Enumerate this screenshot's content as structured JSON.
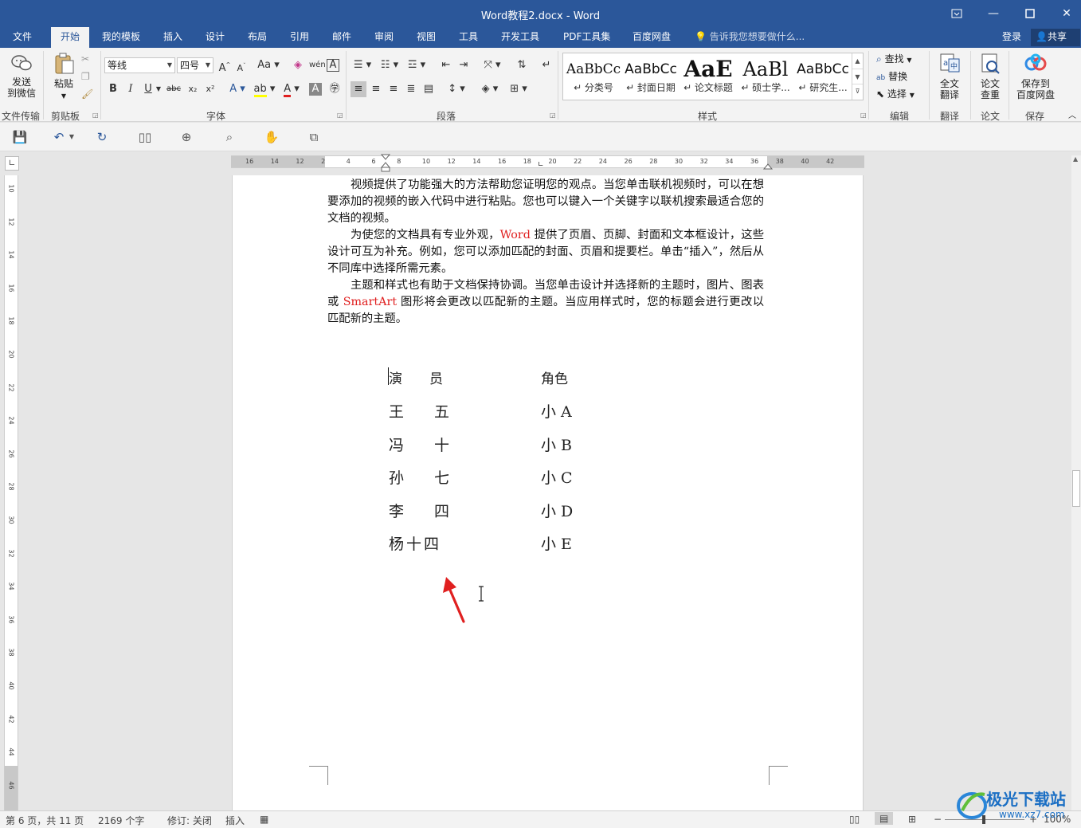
{
  "window": {
    "title": "Word教程2.docx - Word",
    "controls": [
      "restore-ribbon",
      "minimize",
      "maximize",
      "close"
    ]
  },
  "tabs": [
    {
      "label": "文件"
    },
    {
      "label": "开始",
      "active": true
    },
    {
      "label": "我的模板"
    },
    {
      "label": "插入"
    },
    {
      "label": "设计"
    },
    {
      "label": "布局"
    },
    {
      "label": "引用"
    },
    {
      "label": "邮件"
    },
    {
      "label": "审阅"
    },
    {
      "label": "视图"
    },
    {
      "label": "工具"
    },
    {
      "label": "开发工具"
    },
    {
      "label": "PDF工具集"
    },
    {
      "label": "百度网盘"
    }
  ],
  "tellme": "告诉我您想要做什么...",
  "account": {
    "login": "登录",
    "share": "共享"
  },
  "ribbon": {
    "send_wechat": {
      "line1": "发送",
      "line2": "到微信"
    },
    "paste": "粘贴",
    "font_name": "等线",
    "font_size": "四号",
    "groups": {
      "file_transfer": "文件传输",
      "clipboard": "剪贴板",
      "font": "字体",
      "paragraph": "段落",
      "styles": "样式",
      "edit": "编辑",
      "translate": "翻译",
      "thesis": "论文",
      "save": "保存"
    },
    "styles": [
      {
        "preview": "AaBbCc",
        "name": "↵ 分类号"
      },
      {
        "preview": "AaBbCc",
        "name": "↵ 封面日期"
      },
      {
        "preview": "AaE",
        "name": "↵ 论文标题"
      },
      {
        "preview": "AaBl",
        "name": "↵ 硕士学..."
      },
      {
        "preview": "AaBbCc",
        "name": "↵ 研究生..."
      }
    ],
    "edit": {
      "find": "查找",
      "replace": "替换",
      "select": "选择"
    },
    "full_translate": {
      "line1": "全文",
      "line2": "翻译"
    },
    "thesis_check": {
      "line1": "论文",
      "line2": "查重"
    },
    "save_baidu": {
      "line1": "保存到",
      "line2": "百度网盘"
    }
  },
  "ruler": {
    "h_ticks": [
      "16",
      "14",
      "12",
      "2",
      "4",
      "6",
      "8",
      "10",
      "12",
      "14",
      "16",
      "18",
      "20",
      "22",
      "24",
      "26",
      "28",
      "30",
      "32",
      "34",
      "36",
      "38",
      "40",
      "42"
    ],
    "v_ticks": [
      "10",
      "12",
      "14",
      "16",
      "18",
      "20",
      "22",
      "24",
      "26",
      "28",
      "30",
      "32",
      "34",
      "36",
      "38",
      "40",
      "42",
      "44",
      "46"
    ]
  },
  "document": {
    "p1": "视频提供了功能强大的方法帮助您证明您的观点。当您单击联机视频时，可以在想要添加的视频的嵌入代码中进行粘贴。您也可以键入一个关键字以联机搜索最适合您的文档的视频。",
    "p2_a": "为使您的文档具有专业外观，",
    "p2_word": "Word",
    "p2_b": " 提供了页眉、页脚、封面和文本框设计，这些设计可互为补充。例如，您可以添加匹配的封面、页眉和提要栏。单击“插入”，然后从不同库中选择所需元素。",
    "p3_a": "主题和样式也有助于文档保持协调。当您单击设计并选择新的主题时，图片、图表或 ",
    "p3_smartart": "SmartArt",
    "p3_b": " 图形将会更改以匹配新的主题。当应用样式时，您的标题会进行更改以匹配新的主题。",
    "table": {
      "header": {
        "actor": "演　　员",
        "role": "角色"
      },
      "rows": [
        {
          "actor": "王　　五",
          "role": "小 A"
        },
        {
          "actor": "冯　　十",
          "role": "小 B"
        },
        {
          "actor": "孙　　七",
          "role": "小 C"
        },
        {
          "actor": "李　　四",
          "role": "小 D"
        },
        {
          "actor": "杨十四",
          "role": "小 E"
        }
      ]
    }
  },
  "statusbar": {
    "page": "第 6 页，共 11 页",
    "words": "2169 个字",
    "track": "修订: 关闭",
    "insert": "插入",
    "zoom": "100%"
  },
  "watermark": {
    "title": "极光下载站",
    "url": "www.xz7.com"
  },
  "colors": {
    "brand": "#2b579a",
    "red_text": "#e02020",
    "arrow": "#e02020"
  }
}
